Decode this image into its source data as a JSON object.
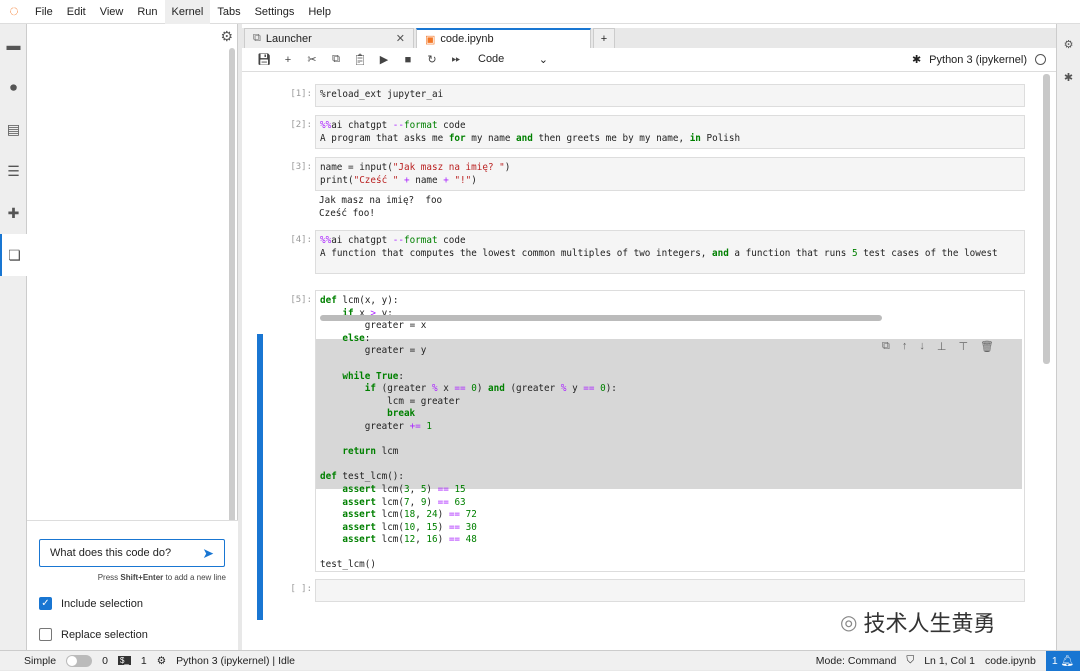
{
  "menu": [
    "File",
    "Edit",
    "View",
    "Run",
    "Kernel",
    "Tabs",
    "Settings",
    "Help"
  ],
  "menu_active": "Kernel",
  "chat": {
    "input_value": "What does this code do?",
    "hint_prefix": "Press ",
    "hint_key": "Shift+Enter",
    "hint_suffix": " to add a new line",
    "include_selection": {
      "label": "Include selection",
      "checked": true
    },
    "replace_selection": {
      "label": "Replace selection",
      "checked": false
    }
  },
  "tabs": [
    {
      "label": "Launcher",
      "active": false
    },
    {
      "label": "code.ipynb",
      "active": true
    }
  ],
  "toolbar": {
    "cell_type": "Code",
    "kernel": "Python 3 (ipykernel)"
  },
  "cells": [
    {
      "prompt": "[1]:",
      "lines": [
        "%reload_ext jupyter_ai"
      ]
    },
    {
      "prompt": "[2]:",
      "lines": [
        "%%ai chatgpt --format code",
        "A program that asks me for my name and then greets me by my name, in Polish"
      ]
    },
    {
      "prompt": "[3]:",
      "lines": [
        "name = input(\"Jak masz na imię? \")",
        "print(\"Cześć \" + name + \"!\")"
      ],
      "output": [
        "Jak masz na imię?  foo",
        "Cześć foo!"
      ]
    },
    {
      "prompt": "[4]:",
      "lines": [
        "%%ai chatgpt --format code",
        "A function that computes the lowest common multiples of two integers, and a function that runs 5 test cases of the lowest"
      ]
    },
    {
      "prompt": "[5]:",
      "lines": [
        "def lcm(x, y):",
        "    if x > y:",
        "        greater = x",
        "    else:",
        "        greater = y",
        "",
        "    while True:",
        "        if (greater % x == 0) and (greater % y == 0):",
        "            lcm = greater",
        "            break",
        "        greater += 1",
        "",
        "    return lcm",
        "",
        "def test_lcm():",
        "    assert lcm(3, 5) == 15",
        "    assert lcm(7, 9) == 63",
        "    assert lcm(18, 24) == 72",
        "    assert lcm(10, 15) == 30",
        "    assert lcm(12, 16) == 48",
        "",
        "test_lcm()"
      ]
    },
    {
      "prompt": "[ ]:",
      "lines": [
        ""
      ]
    }
  ],
  "status": {
    "mode_label": "Simple",
    "terminals": "0",
    "kernels": "1",
    "kernel_status": "Python 3 (ipykernel) | Idle",
    "mode": "Mode: Command",
    "cursor": "Ln 1, Col 1",
    "file": "code.ipynb",
    "notifications": "1"
  },
  "watermark": "技术人生黄勇",
  "colors": {
    "accent": "#1976d2",
    "keyword": "#008000",
    "operator": "#aa22ff",
    "string": "#ba2121"
  }
}
